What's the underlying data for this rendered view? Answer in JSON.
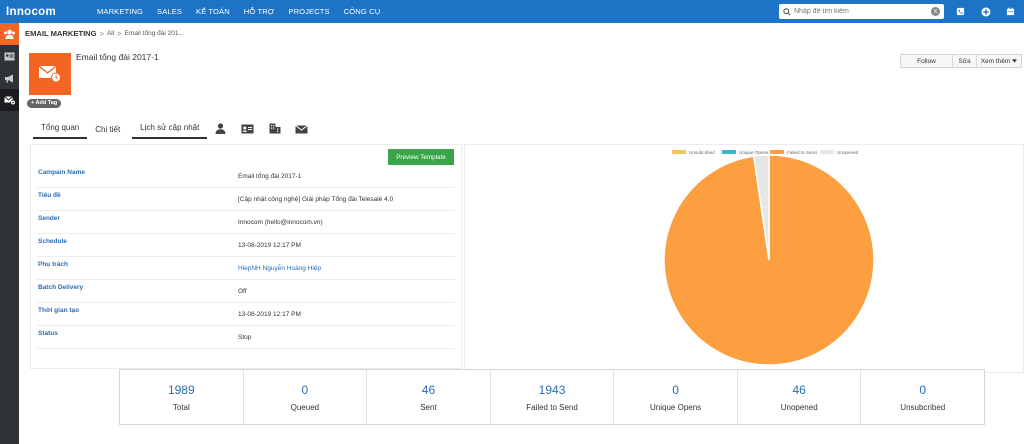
{
  "app": {
    "logo_prefix": "Inn",
    "logo_mid": "o",
    "logo_suffix": "com"
  },
  "nav": {
    "items": [
      "MARKETING",
      "SALES",
      "KẾ TOÁN",
      "HỖ TRỢ",
      "PROJECTS",
      "CÔNG CỤ"
    ]
  },
  "search": {
    "placeholder": "Nhập để tìm kiếm",
    "clear_icon": "x"
  },
  "top_icons": [
    "phone-icon",
    "plus-circle-icon",
    "calendar-icon"
  ],
  "sidebar": {
    "icons": [
      "users-icon",
      "contact-card-icon",
      "megaphone-icon",
      "email-settings-icon"
    ]
  },
  "breadcrumb": {
    "root": "EMAIL MARKETING",
    "sep": ">",
    "all": "All",
    "current": "Email tổng đài 201..."
  },
  "entity": {
    "title": "Email tổng đài 2017-1",
    "add_tag": "+ Add Tag"
  },
  "actions": {
    "follow": "Follow",
    "edit": "Sửa",
    "more": "Xem thêm"
  },
  "tabs": {
    "overview": "Tổng quan",
    "detail": "Chi tiết",
    "history": "Lịch sử cập nhật"
  },
  "details": {
    "preview_button": "Preview Template",
    "rows": [
      {
        "label": "Campain Name",
        "value": "Email tổng đài 2017-1"
      },
      {
        "label": "Tiêu đề",
        "value": "[Cập nhật công nghệ] Giải pháp Tổng đài Telesalé 4.0"
      },
      {
        "label": "Sender",
        "value": "Innocom (hello@innocom.vn)"
      },
      {
        "label": "Schedule",
        "value": "13-08-2019 12:17 PM"
      },
      {
        "label": "Phụ trách",
        "value": "HiepNH Nguyễn Hoàng Hiệp"
      },
      {
        "label": "Batch Delivery",
        "value": "Off"
      },
      {
        "label": "Thời gian tạo",
        "value": "13-08-2019 12:17 PM"
      },
      {
        "label": "Status",
        "value": "Stop"
      }
    ]
  },
  "chart_data": {
    "type": "pie",
    "legend_position": "top",
    "series": [
      {
        "name": "Unsubcribed",
        "value": 0,
        "color": "#f5c35a"
      },
      {
        "name": "Unique Opens",
        "value": 0,
        "color": "#3fb7c9"
      },
      {
        "name": "Failed to Send",
        "value": 1943,
        "color": "#fb9f40"
      },
      {
        "name": "Unopened",
        "value": 46,
        "color": "#e6e6e6"
      }
    ]
  },
  "stats": [
    {
      "value": "1989",
      "label": "Total"
    },
    {
      "value": "0",
      "label": "Queued"
    },
    {
      "value": "46",
      "label": "Sent"
    },
    {
      "value": "1943",
      "label": "Failed to Send"
    },
    {
      "value": "0",
      "label": "Unique Opens"
    },
    {
      "value": "46",
      "label": "Unopened"
    },
    {
      "value": "0",
      "label": "Unsubcribed"
    }
  ]
}
